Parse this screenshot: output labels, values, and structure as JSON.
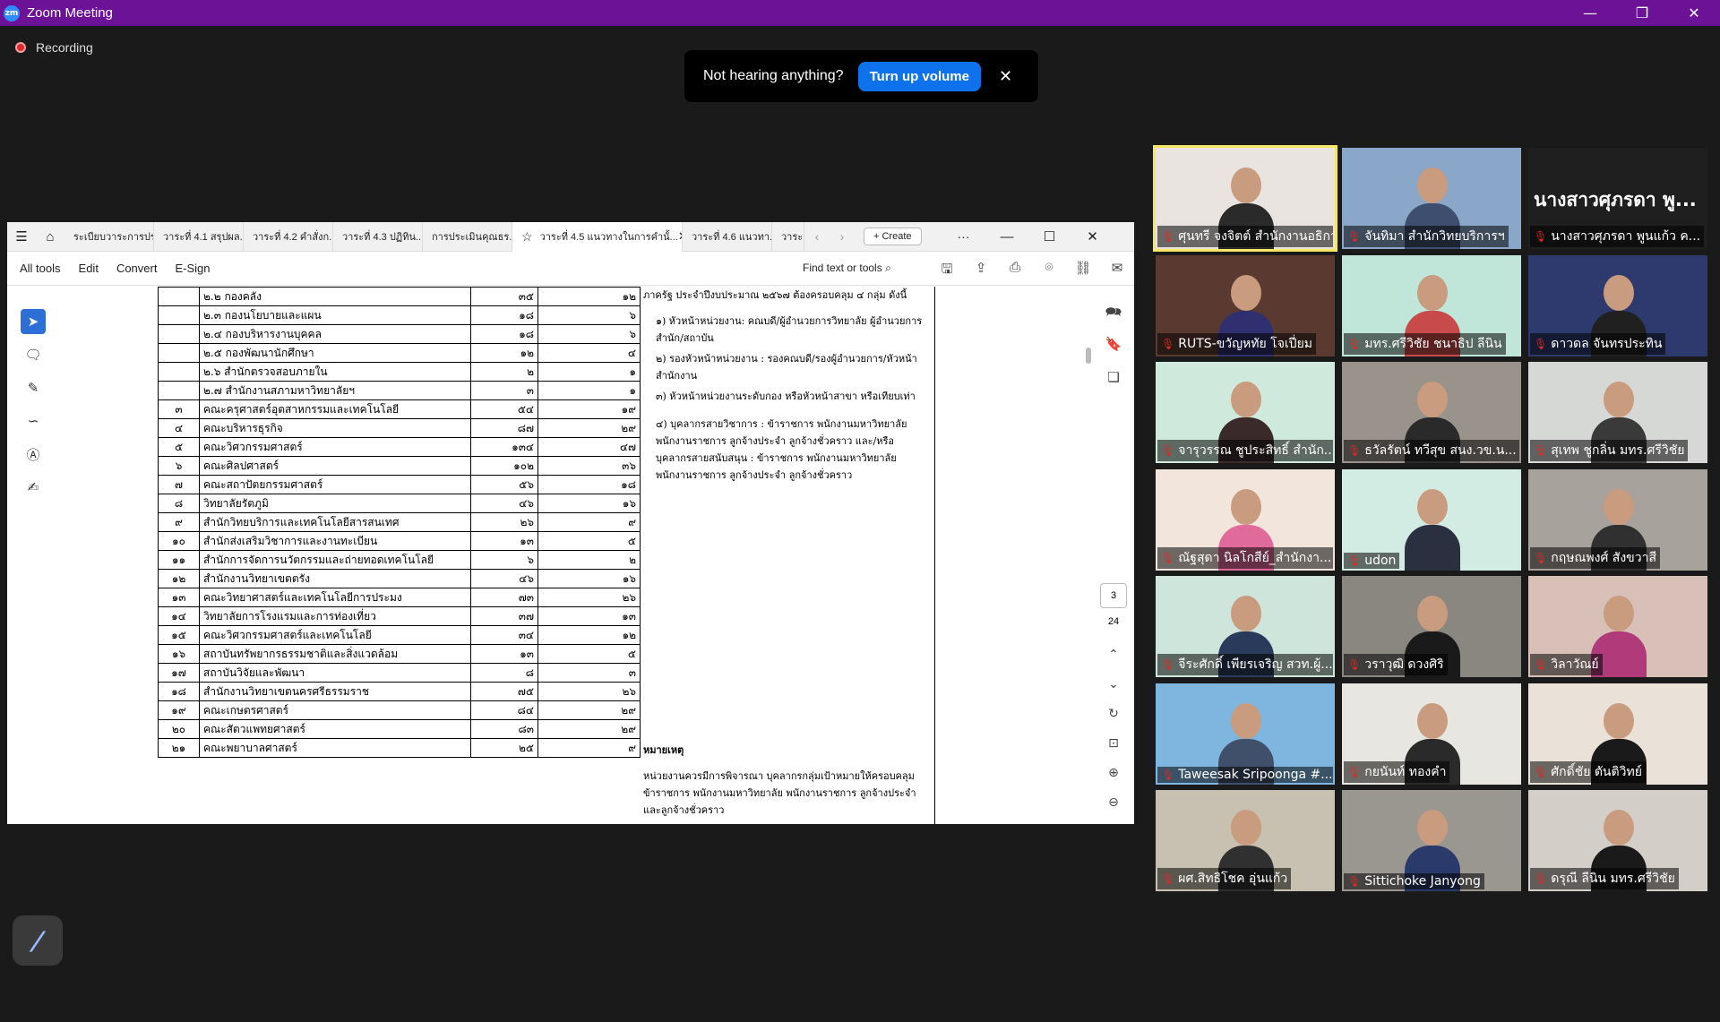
{
  "window": {
    "title": "Zoom Meeting",
    "logo": "zm"
  },
  "recording": {
    "label": "Recording"
  },
  "toast": {
    "message": "Not hearing anything?",
    "button": "Turn up volume"
  },
  "pdf": {
    "tabs": [
      "ระเบียบวาระการประ...",
      "วาระที่ 4.1 สรุปผล...",
      "วาระที่ 4.2 คำสั่งก...",
      "วาระที่ 4.3 ปฏิทิน...",
      "การประเมินคุณธร...",
      "วาระที่ 4.5 แนวทางในการคำนั้...",
      "วาระที่ 4.6 แนวทา...",
      "วาระ"
    ],
    "create": "Create",
    "menu": [
      "All tools",
      "Edit",
      "Convert",
      "E-Sign"
    ],
    "find": "Find text or tools",
    "page_current": "3",
    "page_total": "24"
  },
  "doc": {
    "rows": [
      {
        "no": "",
        "name": "๒.๒ กองคลัง",
        "a": "๓๕",
        "b": "๑๒"
      },
      {
        "no": "",
        "name": "๒.๓ กองนโยบายและแผน",
        "a": "๑๘",
        "b": "๖"
      },
      {
        "no": "",
        "name": "๒.๔ กองบริหารงานบุคคล",
        "a": "๑๘",
        "b": "๖"
      },
      {
        "no": "",
        "name": "๒.๕ กองพัฒนานักศึกษา",
        "a": "๑๒",
        "b": "๔"
      },
      {
        "no": "",
        "name": "๒.๖ สำนักตรวจสอบภายใน",
        "a": "๒",
        "b": "๑"
      },
      {
        "no": "",
        "name": "๒.๗ สำนักงานสภามหาวิทยาลัยฯ",
        "a": "๓",
        "b": "๑"
      },
      {
        "no": "๓",
        "name": "คณะครุศาสตร์อุตสาหกรรมและเทคโนโลยี",
        "a": "๕๔",
        "b": "๑๙"
      },
      {
        "no": "๔",
        "name": "คณะบริหารธุรกิจ",
        "a": "๘๗",
        "b": "๒๙"
      },
      {
        "no": "๕",
        "name": "คณะวิศวกรรมศาสตร์",
        "a": "๑๓๔",
        "b": "๔๗"
      },
      {
        "no": "๖",
        "name": "คณะศิลปศาสตร์",
        "a": "๑๐๒",
        "b": "๓๖"
      },
      {
        "no": "๗",
        "name": "คณะสถาปัตยกรรมศาสตร์",
        "a": "๕๖",
        "b": "๑๘"
      },
      {
        "no": "๘",
        "name": "วิทยาลัยรัตภูมิ",
        "a": "๔๖",
        "b": "๑๖"
      },
      {
        "no": "๙",
        "name": "สำนักวิทยบริการและเทคโนโลยีสารสนเทศ",
        "a": "๒๖",
        "b": "๙"
      },
      {
        "no": "๑๐",
        "name": "สำนักส่งเสริมวิชาการและงานทะเบียน",
        "a": "๑๓",
        "b": "๕"
      },
      {
        "no": "๑๑",
        "name": "สำนักการจัดการนวัตกรรมและถ่ายทอดเทคโนโลยี",
        "a": "๖",
        "b": "๒"
      },
      {
        "no": "๑๒",
        "name": "สำนักงานวิทยาเขตตรัง",
        "a": "๔๖",
        "b": "๑๖"
      },
      {
        "no": "๑๓",
        "name": "คณะวิทยาศาสตร์และเทคโนโลยีการประมง",
        "a": "๗๓",
        "b": "๒๖"
      },
      {
        "no": "๑๔",
        "name": "วิทยาลัยการโรงแรมและการท่องเที่ยว",
        "a": "๓๗",
        "b": "๑๓"
      },
      {
        "no": "๑๕",
        "name": "คณะวิศวกรรมศาสตร์และเทคโนโลยี",
        "a": "๓๔",
        "b": "๑๒"
      },
      {
        "no": "๑๖",
        "name": "สถาบันทรัพยากรธรรมชาติและสิ่งแวดล้อม",
        "a": "๑๓",
        "b": "๕"
      },
      {
        "no": "๑๗",
        "name": "สถาบันวิจัยและพัฒนา",
        "a": "๘",
        "b": "๓"
      },
      {
        "no": "๑๘",
        "name": "สำนักงานวิทยาเขตนครศรีธรรมราช",
        "a": "๗๕",
        "b": "๒๖"
      },
      {
        "no": "๑๙",
        "name": "คณะเกษตรศาสตร์",
        "a": "๘๔",
        "b": "๒๙"
      },
      {
        "no": "๒๐",
        "name": "คณะสัตวแพทยศาสตร์",
        "a": "๘๓",
        "b": "๒๙"
      },
      {
        "no": "๒๑",
        "name": "คณะพยาบาลศาสตร์",
        "a": "๒๕",
        "b": "๙"
      }
    ],
    "para1": "ภาครัฐ ประจำปีงบประมาณ ๒๕๖๗ ต้องครอบคลุม ๔ กลุ่ม ดังนี้",
    "para2": "๑) หัวหน้าหน่วยงาน: คณบดี/ผู้อำนวยการวิทยาลัย ผู้อำนวยการสำนัก/สถาบัน",
    "para3": "๒) รองหัวหน้าหน่วยงาน : รองคณบดี/รองผู้อำนวยการ/หัวหน้าสำนักงาน",
    "para4": "๓) หัวหน้าหน่วยงานระดับกอง หรือหัวหน้าสาขา หรือเทียบเท่า",
    "para5": "๔) บุคลากรสายวิชาการ : ข้าราชการ พนักงานมหาวิทยาลัย พนักงานราชการ ลูกจ้างประจำ ลูกจ้างชั่วคราว และ/หรือ บุคลากรสายสนับสนุน : ข้าราชการ พนักงานมหาวิทยาลัย พนักงานราชการ ลูกจ้างประจำ ลูกจ้างชั่วคราว",
    "note_title": "หมายเหตุ",
    "note_text": "หน่วยงานควรมีการพิจารณา บุคลากรกลุ่มเป้าหมายให้ครอบคลุม ข้าราชการ พนักงานมหาวิทยาลัย พนักงานราชการ ลูกจ้างประจำ และลูกจ้างชั่วคราว"
  },
  "participants": [
    {
      "name": "ศุนทรี จงจิตต์ สำนักงานอธิการ...",
      "bg": "#e9e4e0",
      "body": "#2a2a2a",
      "highlight": true
    },
    {
      "name": "จันทิมา สำนักวิทยบริการฯ",
      "bg": "#8aa6c8",
      "body": "#3e4e6e"
    },
    {
      "name": "นางสาวศุภรดา พูนแก้ว ค...",
      "bg": "#1f1f1f",
      "big": "นางสาวศุภรดา พู..."
    },
    {
      "name": "RUTS-ขวัญหทัย โจเปี่ยม",
      "bg": "#5a3a30",
      "body": "#303070"
    },
    {
      "name": "มทร.ศรีวิชัย ชนาธิป ลีนิน",
      "bg": "#bfe6d8",
      "body": "#c84a4a"
    },
    {
      "name": "ดาวดล จันทรประทิน",
      "bg": "#2e3a6e",
      "body": "#202020"
    },
    {
      "name": "จารุวรรณ ชูประสิทธิ์ สำนัก...",
      "bg": "#cfe9dc",
      "body": "#3a2a2a"
    },
    {
      "name": "ธวัลรัตน์ ทวีสุข สนง.วข.น...",
      "bg": "#9a938c",
      "body": "#2a2a2a"
    },
    {
      "name": "สุเทพ ชูกลิ่น มทร.ศรีวิชัย",
      "bg": "#d6d8d6",
      "body": "#3a3a3a"
    },
    {
      "name": "ณัฐสุดา นิลโกสีย์_สำนักงา...",
      "bg": "#f2e6dc",
      "body": "#e06a9a"
    },
    {
      "name": "udon",
      "bg": "#d2ece4",
      "body": "#2a3040"
    },
    {
      "name": "กฤษณพงศ์ สังขวาสี",
      "bg": "#a8a29c",
      "body": "#303030"
    },
    {
      "name": "จีระศักดิ์ เพียรเจริญ สวท.ผู้...",
      "bg": "#cde5da",
      "body": "#2a3a5a"
    },
    {
      "name": "วราวุฒิ ดวงศิริ",
      "bg": "#8a8680",
      "body": "#1a1a1a"
    },
    {
      "name": "วิลาวัณย์",
      "bg": "#d8c0b8",
      "body": "#b03a7a"
    },
    {
      "name": "Taweesak Sripoonga #...",
      "bg": "#7fb6e0",
      "body": "#40506a"
    },
    {
      "name": "กยนันท์ ทองคำ",
      "bg": "#e8e6e0",
      "body": "#2a2a2a"
    },
    {
      "name": "ศักดิ์ชัย ตันติวิทย์",
      "bg": "#eae2d8",
      "body": "#1a1a1a"
    },
    {
      "name": "ผศ.สิทธิโชค อุ่นแก้ว",
      "bg": "#c8c0b0",
      "body": "#303030"
    },
    {
      "name": "Sittichoke Janyong",
      "bg": "#9a9690",
      "body": "#2a3a6a"
    },
    {
      "name": "ดรุณี ลีนิน มทร.ศรีวิชัย",
      "bg": "#d4cec8",
      "body": "#1a1a1a"
    }
  ]
}
